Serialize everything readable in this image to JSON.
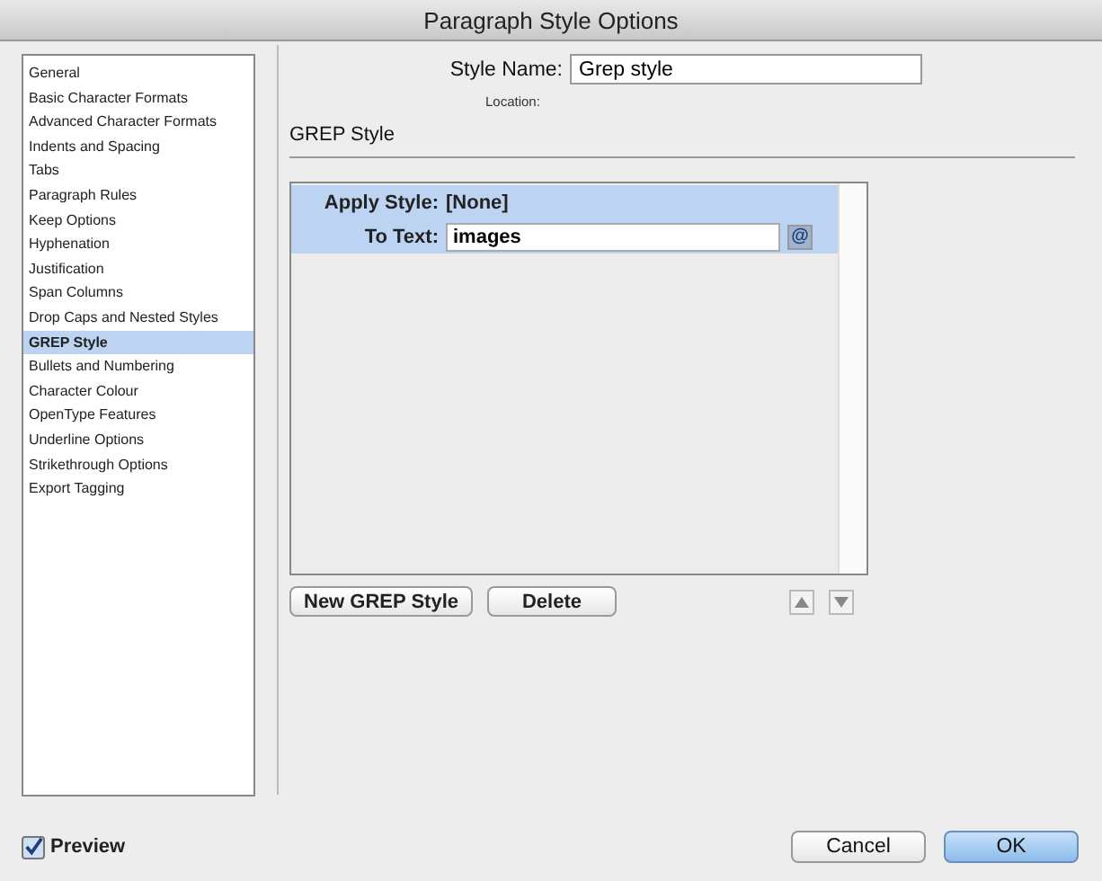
{
  "window": {
    "title": "Paragraph Style Options"
  },
  "sidebar": {
    "items": [
      {
        "label": "General",
        "selected": false
      },
      {
        "label": "Basic Character Formats",
        "selected": false
      },
      {
        "label": "Advanced Character Formats",
        "selected": false
      },
      {
        "label": "Indents and Spacing",
        "selected": false
      },
      {
        "label": "Tabs",
        "selected": false
      },
      {
        "label": "Paragraph Rules",
        "selected": false
      },
      {
        "label": "Keep Options",
        "selected": false
      },
      {
        "label": "Hyphenation",
        "selected": false
      },
      {
        "label": "Justification",
        "selected": false
      },
      {
        "label": "Span Columns",
        "selected": false
      },
      {
        "label": "Drop Caps and Nested Styles",
        "selected": false
      },
      {
        "label": "GREP Style",
        "selected": true
      },
      {
        "label": "Bullets and Numbering",
        "selected": false
      },
      {
        "label": "Character Colour",
        "selected": false
      },
      {
        "label": "OpenType Features",
        "selected": false
      },
      {
        "label": "Underline Options",
        "selected": false
      },
      {
        "label": "Strikethrough Options",
        "selected": false
      },
      {
        "label": "Export Tagging",
        "selected": false
      }
    ]
  },
  "style_name": {
    "label": "Style Name:",
    "value": "Grep style"
  },
  "location": {
    "label": "Location:"
  },
  "section_title": "GREP Style",
  "grep_rule": {
    "apply_label": "Apply Style:",
    "apply_value": "[None]",
    "text_label": "To Text:",
    "text_value": "images",
    "menu_icon": "@"
  },
  "list_buttons": [
    {
      "label": "New GREP Style"
    },
    {
      "label": "Delete"
    }
  ],
  "preview": {
    "label": "Preview",
    "checked": true
  },
  "buttons": [
    {
      "label": "Cancel",
      "default": false
    },
    {
      "label": "OK",
      "default": true
    }
  ]
}
